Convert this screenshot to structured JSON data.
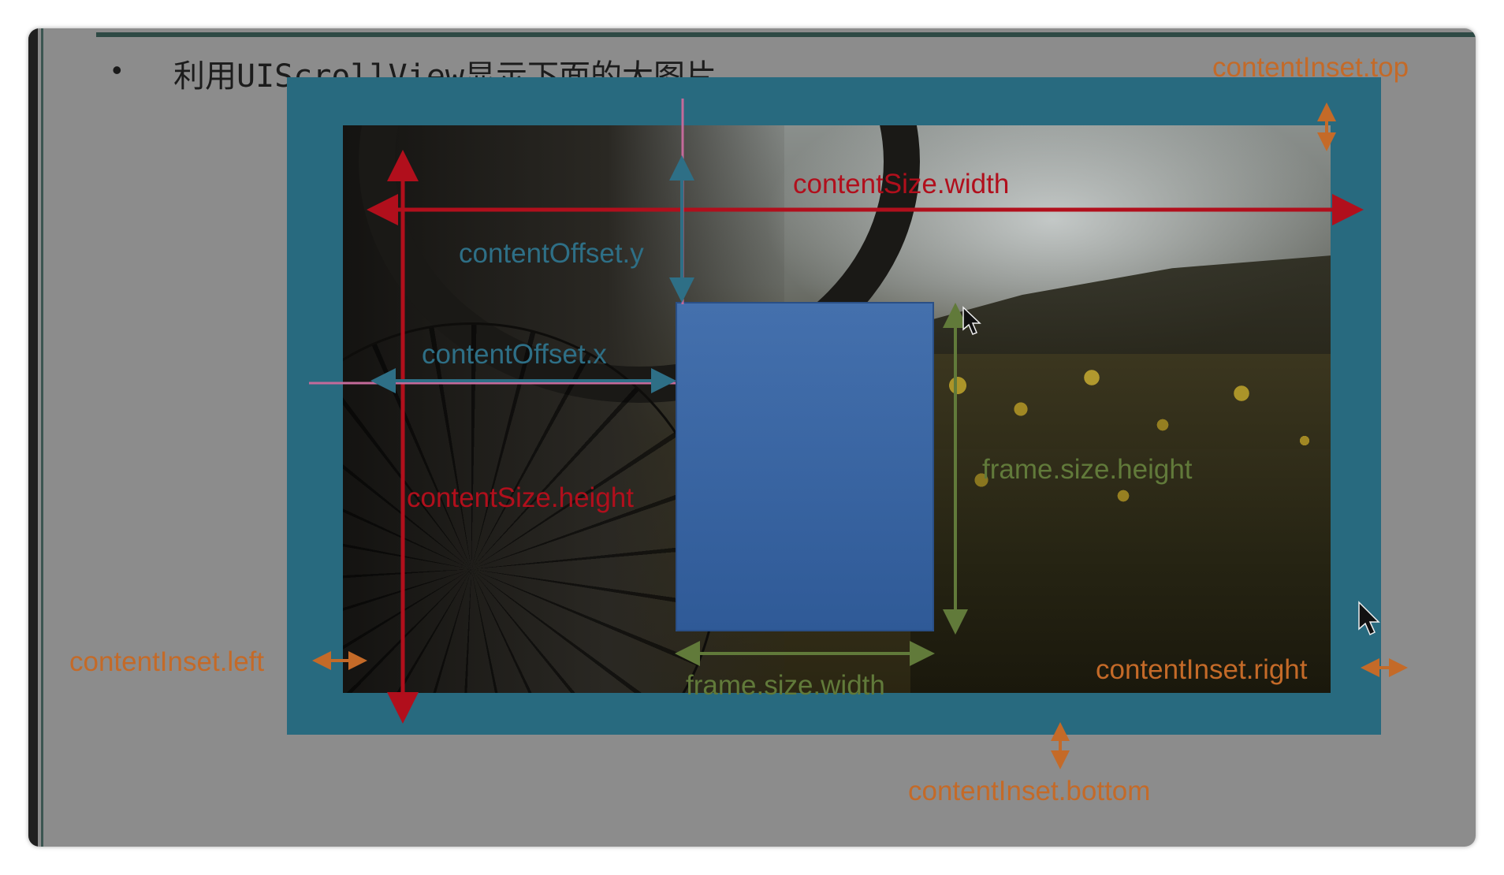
{
  "slide": {
    "bullet": "•",
    "title": "利用UIScrollView显示下面的大图片"
  },
  "labels": {
    "content_size_width": "contentSize.width",
    "content_size_height": "contentSize.height",
    "content_offset_x": "contentOffset.x",
    "content_offset_y": "contentOffset.y",
    "frame_size_width": "frame.size.width",
    "frame_size_height": "frame.size.height",
    "content_inset_top": "contentInset.top",
    "content_inset_left": "contentInset.left",
    "content_inset_right": "contentInset.right",
    "content_inset_bottom": "contentInset.bottom"
  },
  "colors": {
    "slide_background": "#8c8c8c",
    "inset_area": "#286a7f",
    "scroll_frame": "#3a66a3",
    "content_size": "#b10f1c",
    "content_offset": "#2e6f86",
    "offset_guide": "#c46a9a",
    "frame_size": "#617a3a",
    "content_inset": "#c46a28"
  },
  "icons": [
    "mouse-pointer-icon",
    "mouse-pointer-icon"
  ]
}
